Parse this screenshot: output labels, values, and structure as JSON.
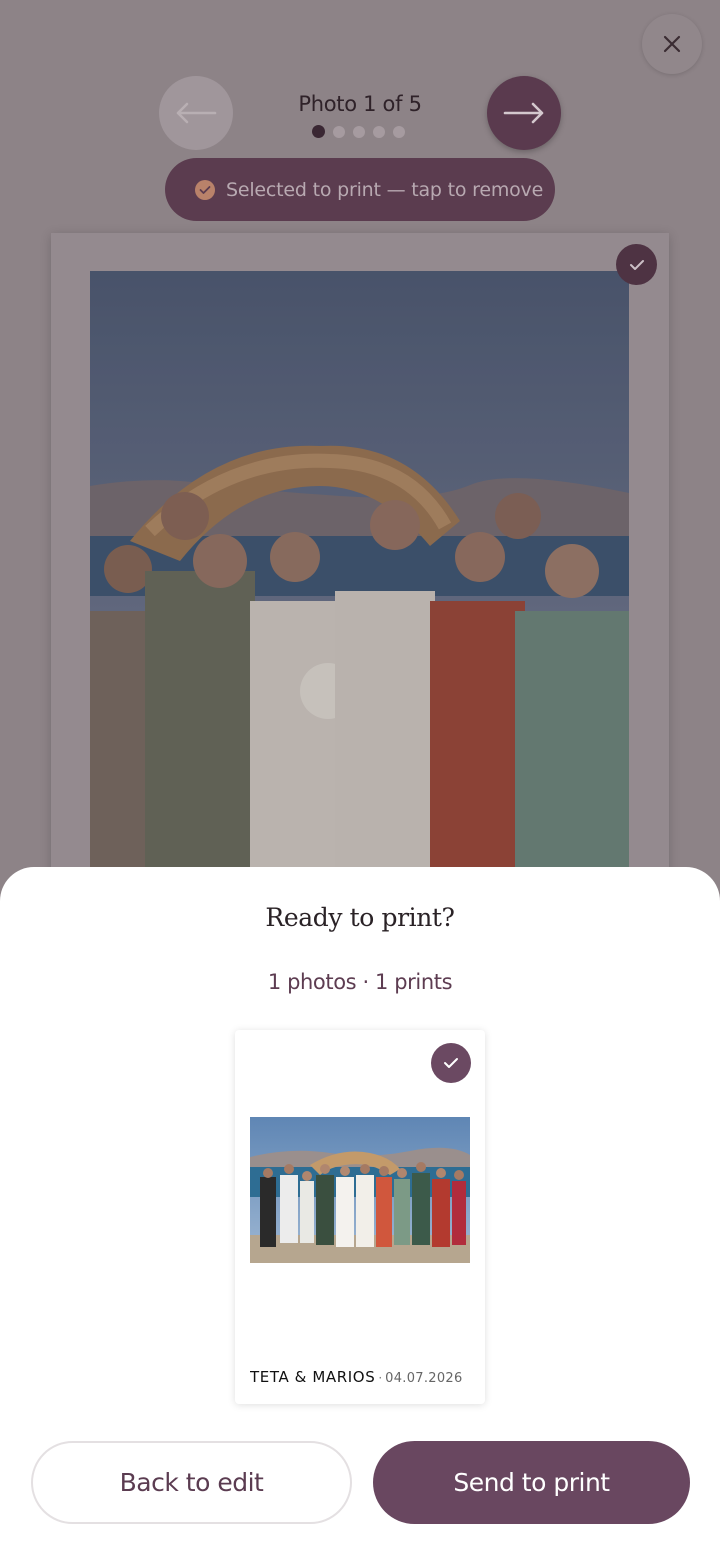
{
  "viewer": {
    "counter": "Photo 1 of 5",
    "dots_total": 5,
    "dots_active_index": 0,
    "selected_pill": "Selected to print — tap to remove",
    "icons": {
      "close": "close-icon",
      "prev": "arrow-left-icon",
      "next": "arrow-right-icon",
      "pill_check": "check-circle-icon",
      "card_check": "check-icon"
    }
  },
  "sheet": {
    "title": "Ready to print?",
    "subtitle": "1 photos · 1 prints",
    "thumbnail": {
      "caption_names": "TETA & MARIOS",
      "caption_separator": "·",
      "caption_date": "04.07.2026"
    },
    "back_button": "Back to edit",
    "send_button": "Send to print"
  },
  "colors": {
    "accent": "#694760",
    "accent_dark": "#5b3c4f",
    "overlay": "#8d8387",
    "pill_check": "#b9826a"
  }
}
